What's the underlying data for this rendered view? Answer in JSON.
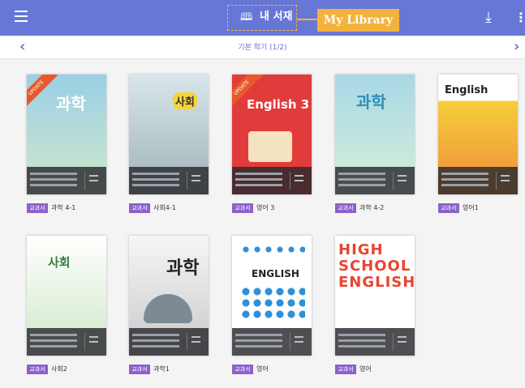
{
  "header": {
    "title": "내 서재",
    "callout": "My Library",
    "menu_icon": "hamburger-icon",
    "book_icon": "open-book-icon",
    "download_icon": "download-icon",
    "more_icon": "more-vertical-icon"
  },
  "subheader": {
    "term": "기본 학기 (1/2)",
    "prev_icon": "chevron-left-icon",
    "next_icon": "chevron-right-icon"
  },
  "badge_label": "교과서",
  "books": [
    {
      "name": "과학 4-1",
      "cover_title": "과학",
      "cover_color": "#9bcfe6",
      "ribbon": "UPDATE"
    },
    {
      "name": "사회4-1",
      "cover_title": "사회",
      "cover_color": "#b9d0d6"
    },
    {
      "name": "영어 3",
      "cover_title": "English 3",
      "cover_color": "#e23b3b",
      "ribbon": "UPDATE"
    },
    {
      "name": "과학 4-2",
      "cover_title": "과학",
      "cover_color": "#a8d8e6"
    },
    {
      "name": "영어1",
      "cover_title": "English",
      "cover_color": "#f5cf3a"
    },
    {
      "name": "사회2",
      "cover_title": "사회",
      "cover_color": "#e8f0e8"
    },
    {
      "name": "과학1",
      "cover_title": "과학",
      "cover_color": "#f0f0f0"
    },
    {
      "name": "영어",
      "cover_title": "ENGLISH",
      "cover_color": "#ffffff"
    },
    {
      "name": "영어",
      "cover_title": "HIGH SCHOOL ENGLISH",
      "cover_color": "#ffffff"
    }
  ]
}
